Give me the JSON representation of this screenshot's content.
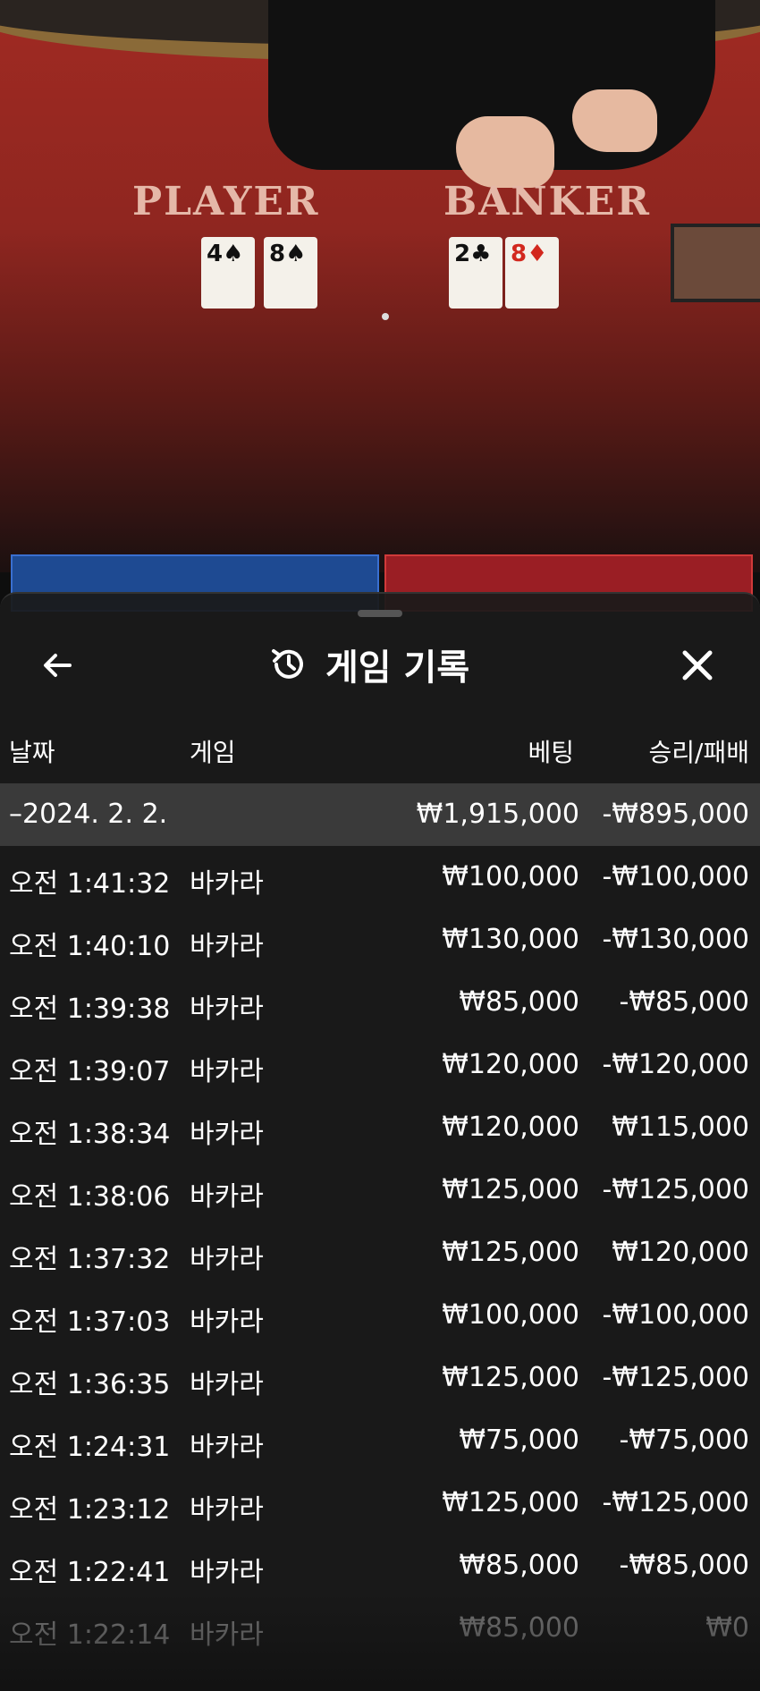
{
  "video": {
    "player_label": "PLAYER",
    "banker_label": "BANKER",
    "player_cards": [
      {
        "rank": "4",
        "suit": "♠"
      },
      {
        "rank": "8",
        "suit": "♠"
      }
    ],
    "banker_cards": [
      {
        "rank": "2",
        "suit": "♣"
      },
      {
        "rank": "8",
        "suit": "♦"
      }
    ]
  },
  "header": {
    "title": "게임 기록",
    "back_icon": "arrow-left-icon",
    "history_icon": "history-icon",
    "close_icon": "close-icon"
  },
  "columns": {
    "date": "날짜",
    "game": "게임",
    "bet": "베팅",
    "result": "승리/패배"
  },
  "summary": {
    "date": "–2024. 2. 2.",
    "bet": "₩1,915,000",
    "result": "-₩895,000"
  },
  "rows": [
    {
      "time": "오전 1:41:32",
      "game": "바카라",
      "bet": "₩100,000",
      "result": "-₩100,000"
    },
    {
      "time": "오전 1:40:10",
      "game": "바카라",
      "bet": "₩130,000",
      "result": "-₩130,000"
    },
    {
      "time": "오전 1:39:38",
      "game": "바카라",
      "bet": "₩85,000",
      "result": "-₩85,000"
    },
    {
      "time": "오전 1:39:07",
      "game": "바카라",
      "bet": "₩120,000",
      "result": "-₩120,000"
    },
    {
      "time": "오전 1:38:34",
      "game": "바카라",
      "bet": "₩120,000",
      "result": "₩115,000"
    },
    {
      "time": "오전 1:38:06",
      "game": "바카라",
      "bet": "₩125,000",
      "result": "-₩125,000"
    },
    {
      "time": "오전 1:37:32",
      "game": "바카라",
      "bet": "₩125,000",
      "result": "₩120,000"
    },
    {
      "time": "오전 1:37:03",
      "game": "바카라",
      "bet": "₩100,000",
      "result": "-₩100,000"
    },
    {
      "time": "오전 1:36:35",
      "game": "바카라",
      "bet": "₩125,000",
      "result": "-₩125,000"
    },
    {
      "time": "오전 1:24:31",
      "game": "바카라",
      "bet": "₩75,000",
      "result": "-₩75,000"
    },
    {
      "time": "오전 1:23:12",
      "game": "바카라",
      "bet": "₩125,000",
      "result": "-₩125,000"
    },
    {
      "time": "오전 1:22:41",
      "game": "바카라",
      "bet": "₩85,000",
      "result": "-₩85,000"
    },
    {
      "time": "오전 1:22:14",
      "game": "바카라",
      "bet": "₩85,000",
      "result": "₩0"
    }
  ],
  "colors": {
    "sheet_bg": "#1a1a1a",
    "summary_bg": "#3a3a3a",
    "text": "#ffffff"
  }
}
